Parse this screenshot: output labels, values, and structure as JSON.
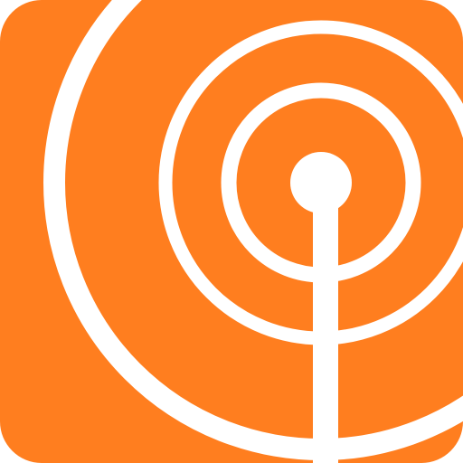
{
  "icon": {
    "name": "broadcast-antenna-icon",
    "background_color": "#FF7E1F",
    "foreground_color": "#FFFFFF"
  }
}
